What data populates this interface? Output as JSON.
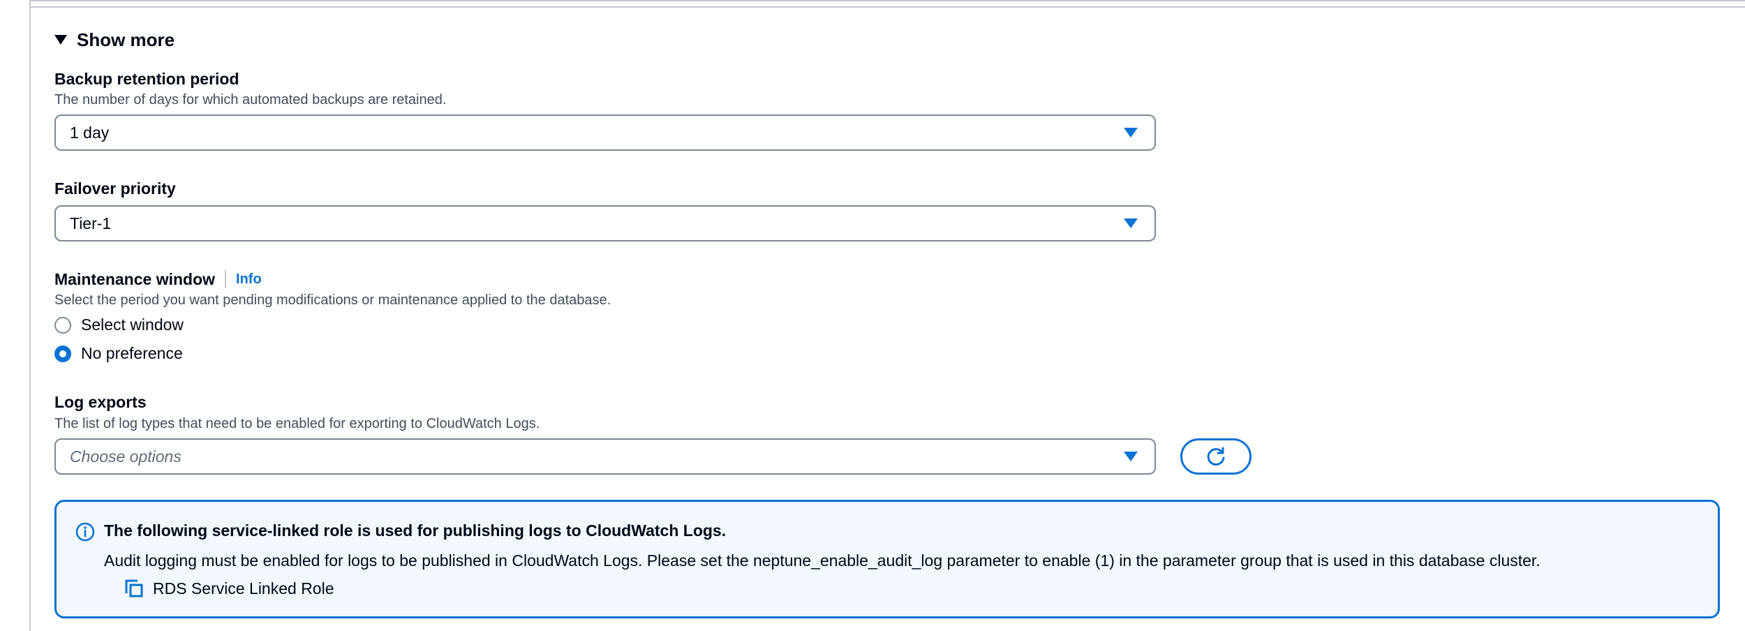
{
  "expander": {
    "label": "Show more"
  },
  "backup": {
    "label": "Backup retention period",
    "description": "The number of days for which automated backups are retained.",
    "value": "1 day"
  },
  "failover": {
    "label": "Failover priority",
    "value": "Tier-1"
  },
  "maintenance": {
    "label": "Maintenance window",
    "info_link": "Info",
    "description": "Select the period you want pending modifications or maintenance applied to the database.",
    "options": [
      {
        "label": "Select window",
        "checked": false
      },
      {
        "label": "No preference",
        "checked": true
      }
    ]
  },
  "log_exports": {
    "label": "Log exports",
    "description": "The list of log types that need to be enabled for exporting to CloudWatch Logs.",
    "placeholder": "Choose options",
    "refresh_icon": "refresh-icon"
  },
  "alert": {
    "icon": "info-circle-icon",
    "title": "The following service-linked role is used for publishing logs to CloudWatch Logs.",
    "body": "Audit logging must be enabled for logs to be published in CloudWatch Logs. Please set the neptune_enable_audit_log parameter to enable (1) in the parameter group that is used in this database cluster.",
    "link_icon": "copy-icon",
    "link_label": "RDS Service Linked Role"
  },
  "colors": {
    "accent": "#0972d3",
    "text": "#000716",
    "secondary_text": "#414d5c",
    "border": "#7d8998",
    "alert_bg": "#f2f8fd"
  }
}
